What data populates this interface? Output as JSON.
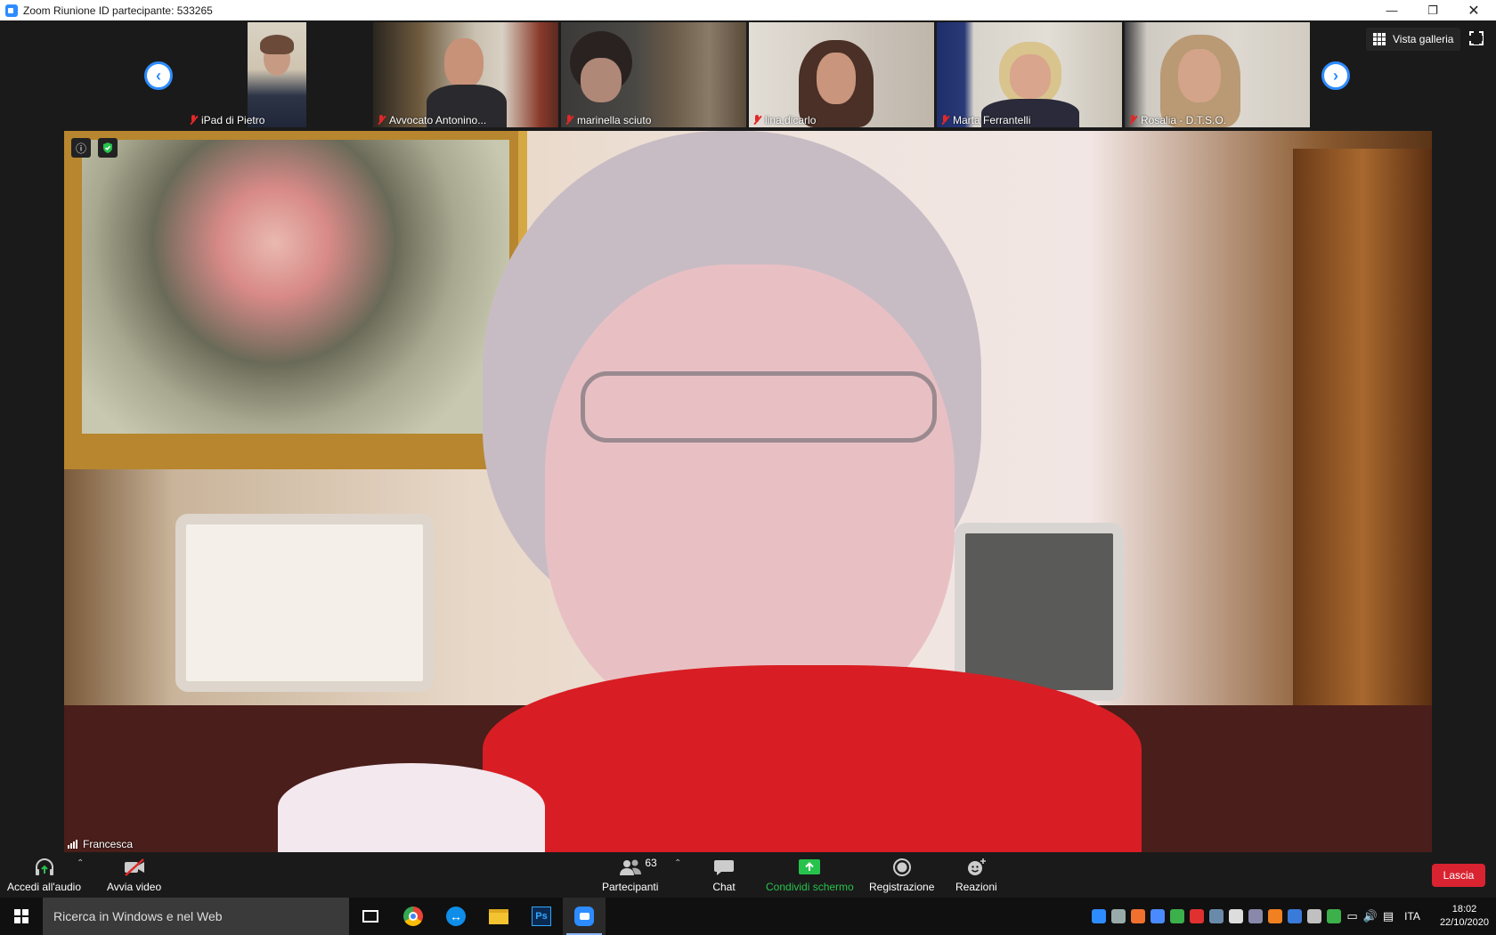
{
  "window": {
    "title": "Zoom Riunione ID partecipante: 533265"
  },
  "gallery": {
    "view_label": "Vista galleria",
    "participants": [
      {
        "name": "iPad di Pietro"
      },
      {
        "name": "Avvocato Antonino..."
      },
      {
        "name": "marinella sciuto"
      },
      {
        "name": "lina.dicarlo"
      },
      {
        "name": "Marta Ferrantelli"
      },
      {
        "name": "Rosalia - D.T.S.O."
      }
    ]
  },
  "main_video": {
    "speaker_name": "Francesca"
  },
  "controls": {
    "audio_label": "Accedi all'audio",
    "video_label": "Avvia video",
    "participants_label": "Partecipanti",
    "participants_count": "63",
    "chat_label": "Chat",
    "share_label": "Condividi schermo",
    "record_label": "Registrazione",
    "reactions_label": "Reazioni",
    "leave_label": "Lascia"
  },
  "taskbar": {
    "search_placeholder": "Ricerca in Windows e nel Web",
    "language": "ITA",
    "time": "18:02",
    "date": "22/10/2020"
  },
  "colors": {
    "zoom_blue": "#2d8cff",
    "share_green": "#27c24c",
    "leave_red": "#d92331",
    "muted_red": "#e02828"
  }
}
